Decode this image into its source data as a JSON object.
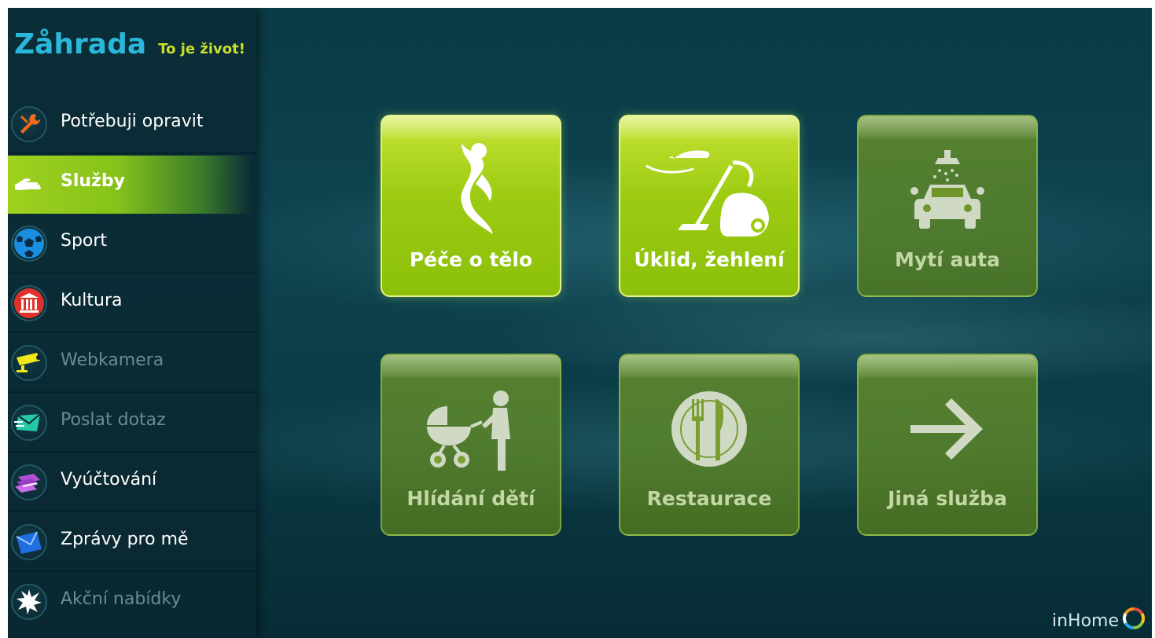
{
  "header": {
    "brand": "Zåhrada",
    "tagline": "To je život!"
  },
  "sidebar": {
    "items": [
      {
        "label": "Potřebuji opravit",
        "icon": "wrench-icon",
        "state": "normal"
      },
      {
        "label": "Služby",
        "icon": "hand-icon",
        "state": "active"
      },
      {
        "label": "Sport",
        "icon": "soccer-ball-icon",
        "state": "normal"
      },
      {
        "label": "Kultura",
        "icon": "museum-icon",
        "state": "normal"
      },
      {
        "label": "Webkamera",
        "icon": "camera-icon",
        "state": "disabled"
      },
      {
        "label": "Poslat dotaz",
        "icon": "send-mail-icon",
        "state": "disabled"
      },
      {
        "label": "Vyúčtování",
        "icon": "billing-icon",
        "state": "normal"
      },
      {
        "label": "Zprávy pro mě",
        "icon": "envelope-icon",
        "state": "normal"
      },
      {
        "label": "Akční nabídky",
        "icon": "star-burst-icon",
        "state": "disabled"
      }
    ]
  },
  "tiles": [
    {
      "label": "Péče o tělo",
      "icon": "body-care-icon",
      "state": "enabled"
    },
    {
      "label": "Úklid, žehlení",
      "icon": "vacuum-iron-icon",
      "state": "enabled"
    },
    {
      "label": "Mytí auta",
      "icon": "car-wash-icon",
      "state": "disabled"
    },
    {
      "label": "Hlídání dětí",
      "icon": "babysitting-icon",
      "state": "disabled"
    },
    {
      "label": "Restaurace",
      "icon": "plate-cutlery-icon",
      "state": "disabled"
    },
    {
      "label": "Jiná služba",
      "icon": "arrow-right-icon",
      "state": "disabled"
    }
  ],
  "footer": {
    "brand": "inHome"
  },
  "colors": {
    "accent": "#9fd11f",
    "brand_blue": "#2ab7d9",
    "brand_lime": "#c8e02b",
    "background": "#0b3d48"
  }
}
